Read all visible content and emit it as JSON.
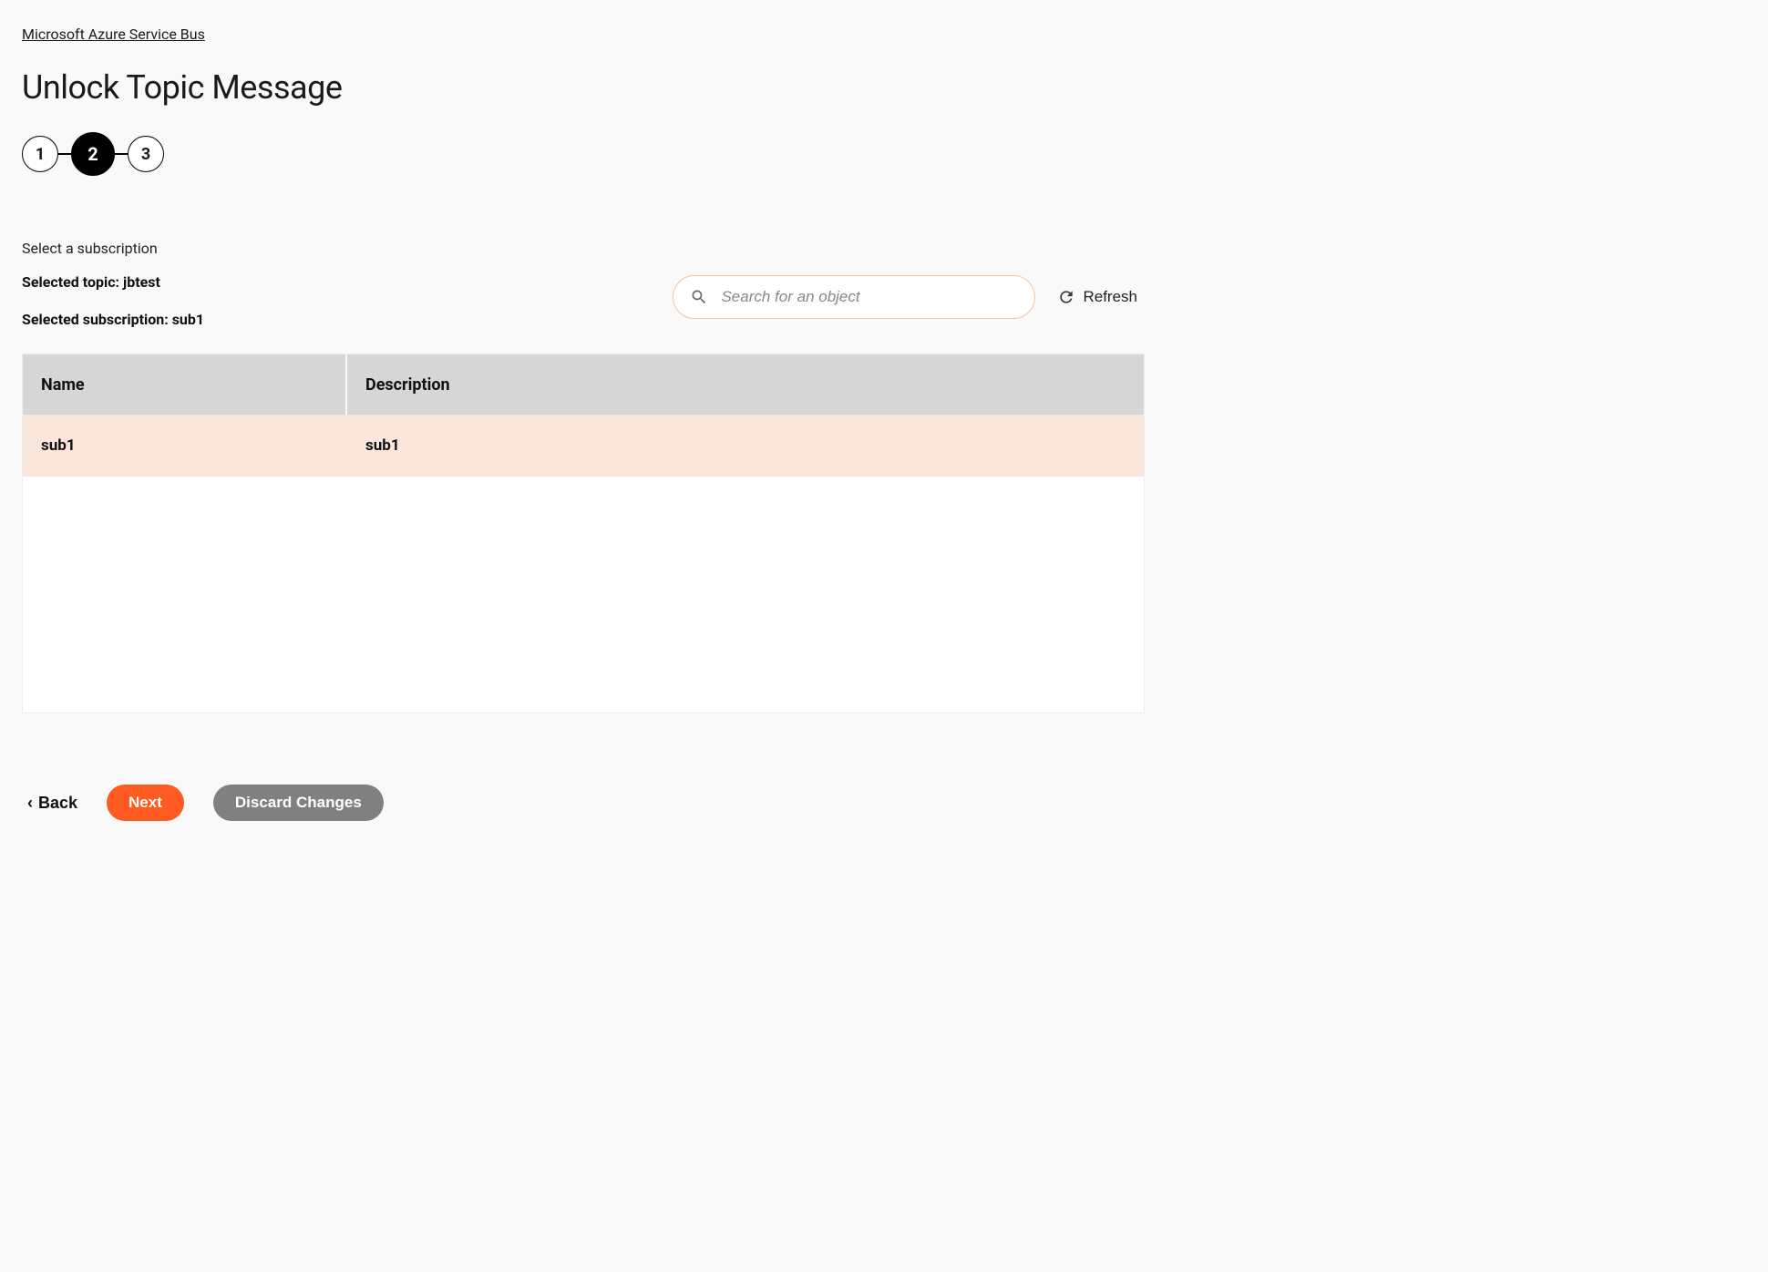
{
  "breadcrumb": {
    "label": "Microsoft Azure Service Bus"
  },
  "page": {
    "title": "Unlock Topic Message"
  },
  "stepper": {
    "steps": [
      "1",
      "2",
      "3"
    ],
    "active_index": 1
  },
  "info": {
    "instruction": "Select a subscription",
    "selected_topic_label": "Selected topic: jbtest",
    "selected_subscription_label": "Selected subscription: sub1"
  },
  "search": {
    "placeholder": "Search for an object",
    "value": ""
  },
  "refresh": {
    "label": "Refresh"
  },
  "table": {
    "headers": {
      "name": "Name",
      "description": "Description"
    },
    "rows": [
      {
        "name": "sub1",
        "description": "sub1",
        "selected": true
      }
    ]
  },
  "footer": {
    "back_label": "Back",
    "next_label": "Next",
    "discard_label": "Discard Changes"
  }
}
